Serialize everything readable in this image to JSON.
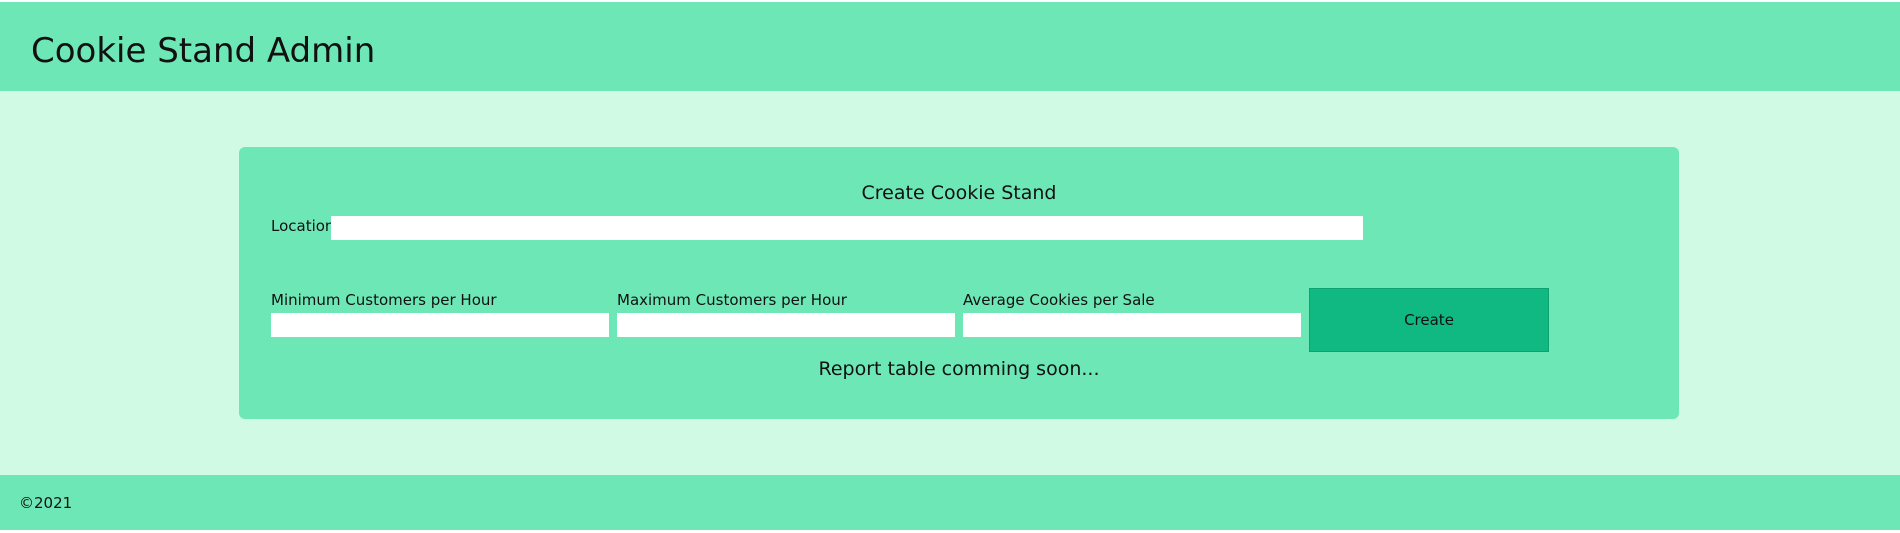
{
  "header": {
    "title": "Cookie Stand Admin"
  },
  "form": {
    "title": "Create Cookie Stand",
    "location_label": "Location",
    "location_value": "",
    "min_customers_label": "Minimum Customers per Hour",
    "min_customers_value": "",
    "max_customers_label": "Maximum Customers per Hour",
    "max_customers_value": "",
    "avg_cookies_label": "Average Cookies per Sale",
    "avg_cookies_value": "",
    "create_button_label": "Create"
  },
  "report": {
    "message": "Report table comming soon..."
  },
  "footer": {
    "copyright": "©2021"
  },
  "colors": {
    "header_bg": "#6ee7b7",
    "main_bg": "#d1fae5",
    "card_bg": "#6ee7b7",
    "button_bg": "#10b981",
    "footer_bg": "#6ee7b7"
  }
}
